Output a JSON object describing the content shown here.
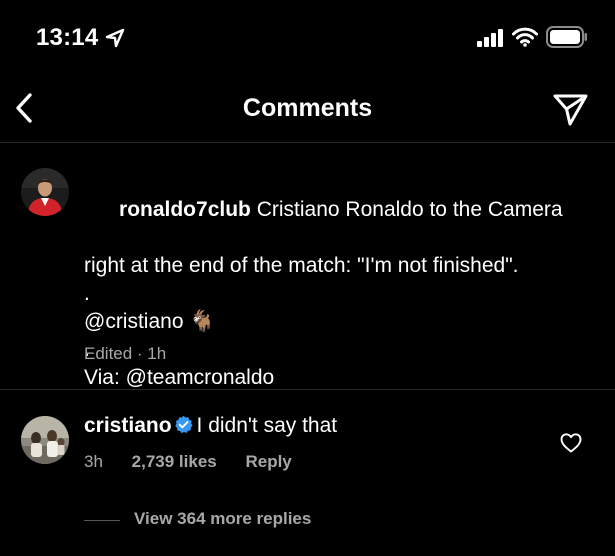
{
  "status_bar": {
    "time": "13:14"
  },
  "header": {
    "title": "Comments"
  },
  "caption": {
    "username": "ronaldo7club",
    "lines": [
      "Cristiano Ronaldo to the Camera",
      "right at the end of the match: \"I'm not finished\".",
      ".",
      "@cristiano 🐐",
      ".",
      "Via: @teamcronaldo"
    ],
    "meta": "Edited · 1h"
  },
  "comment": {
    "username": "cristiano",
    "text": "I didn't say that",
    "time": "3h",
    "likes": "2,739 likes",
    "reply_label": "Reply",
    "view_replies": "View 364 more replies"
  },
  "colors": {
    "background": "#000000",
    "text": "#ffffff",
    "secondary_text": "#a8a8a8",
    "divider": "#262626",
    "verified_badge": "#3897f0"
  },
  "icons": {
    "status_bar": [
      "location-arrow-icon",
      "cellular-signal-icon",
      "wifi-icon",
      "battery-icon"
    ],
    "header": [
      "chevron-left-icon",
      "send-icon"
    ],
    "comment": [
      "verified-badge-icon",
      "heart-icon"
    ]
  }
}
